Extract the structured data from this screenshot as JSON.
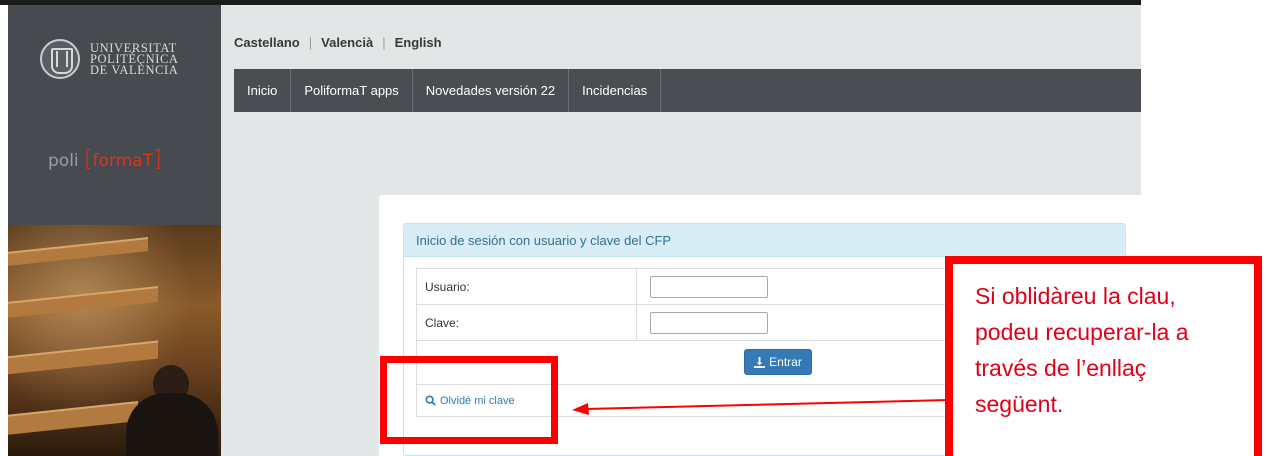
{
  "sidebar": {
    "university": [
      "UNIVERSITAT",
      "POLITÈCNICA",
      "DE VALÈNCIA"
    ],
    "logo": {
      "prefix": "poli",
      "brand": "formaT"
    }
  },
  "header": {
    "languages": [
      "Castellano",
      "Valencià",
      "English"
    ]
  },
  "nav": {
    "items": [
      "Inicio",
      "PoliformaT apps",
      "Novedades versión 22",
      "Incidencias"
    ]
  },
  "login": {
    "title": "Inicio de sesión con usuario y clave del CFP",
    "user_label": "Usuario:",
    "user_value": "",
    "password_label": "Clave:",
    "password_value": "",
    "submit_label": "Entrar",
    "forgot_label": "Olvidé mi clave"
  },
  "annotation": {
    "lines": [
      "Si oblidàreu la clau,",
      "podeu recuperar-la a",
      "través de l’enllaç",
      "següent."
    ],
    "color": "#ff0000"
  },
  "colors": {
    "sidebar": "#474b50",
    "navbar": "#4a4e52",
    "accent": "#e2311d",
    "primary": "#337ab7"
  }
}
